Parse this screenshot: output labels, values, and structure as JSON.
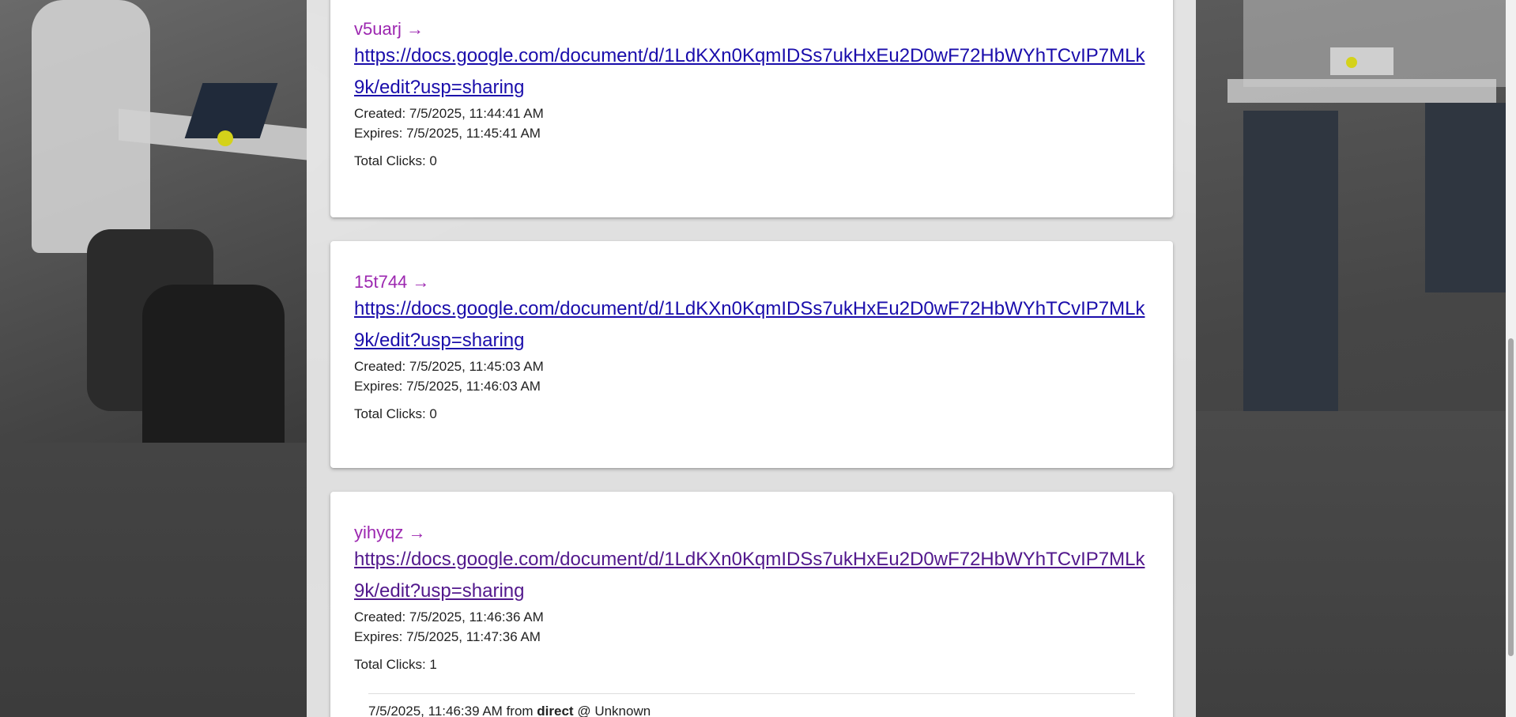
{
  "links": [
    {
      "short": "v5uarj",
      "arrow": "→",
      "url": "https://docs.google.com/document/d/1LdKXn0KqmIDSs7ukHxEu2D0wF72HbWYhTCvIP7MLk9k/edit?usp=sharing",
      "created": "Created: 7/5/2025, 11:44:41 AM",
      "expires": "Expires: 7/5/2025, 11:45:41 AM",
      "clicks": "Total Clicks: 0"
    },
    {
      "short": "15t744",
      "arrow": "→",
      "url": "https://docs.google.com/document/d/1LdKXn0KqmIDSs7ukHxEu2D0wF72HbWYhTCvIP7MLk9k/edit?usp=sharing",
      "created": "Created: 7/5/2025, 11:45:03 AM",
      "expires": "Expires: 7/5/2025, 11:46:03 AM",
      "clicks": "Total Clicks: 0"
    },
    {
      "short": "yihyqz",
      "arrow": "→",
      "url": "https://docs.google.com/document/d/1LdKXn0KqmIDSs7ukHxEu2D0wF72HbWYhTCvIP7MLk9k/edit?usp=sharing",
      "created": "Created: 7/5/2025, 11:46:36 AM",
      "expires": "Expires: 7/5/2025, 11:47:36 AM",
      "clicks": "Total Clicks: 1",
      "click_log": [
        {
          "time": "7/5/2025, 11:46:39 AM",
          "from_label": "from",
          "source": "direct",
          "at": "@",
          "location": "Unknown"
        }
      ]
    }
  ],
  "colors": {
    "short_code": "#9c27b0",
    "link": "#1a0dab",
    "visited_link": "#52188c"
  }
}
